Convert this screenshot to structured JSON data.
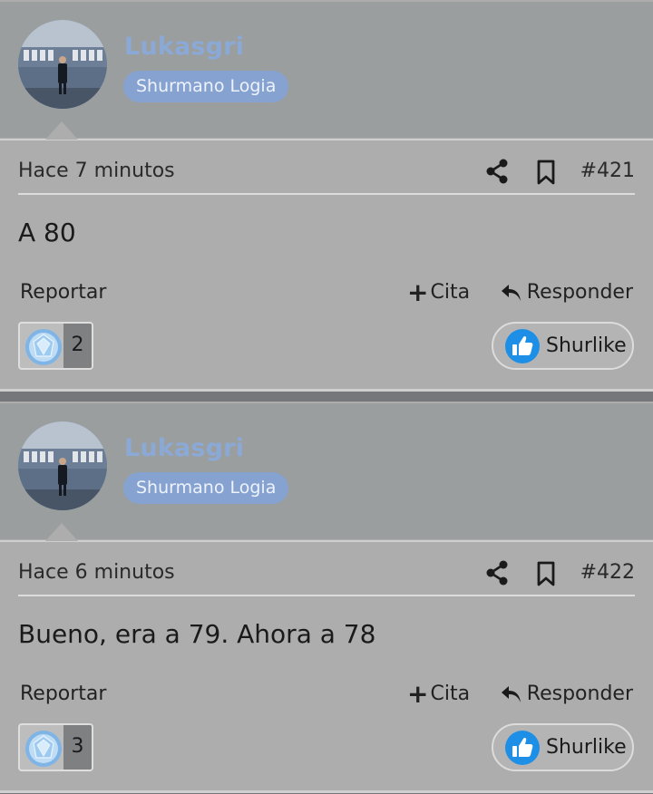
{
  "posts": [
    {
      "author": "Lukasgri",
      "user_title": "Shurmano Logia",
      "time": "Hace 7 minutos",
      "number": "#421",
      "message": "A 80",
      "report_label": "Reportar",
      "quote_label": "Cita",
      "reply_label": "Responder",
      "reaction_count": "2",
      "like_label": "Shurlike"
    },
    {
      "author": "Lukasgri",
      "user_title": "Shurmano Logia",
      "time": "Hace 6 minutos",
      "number": "#422",
      "message": "Bueno, era a 79. Ahora a 78",
      "report_label": "Reportar",
      "quote_label": "Cita",
      "reply_label": "Responder",
      "reaction_count": "3",
      "like_label": "Shurlike"
    }
  ],
  "icons": {
    "share": "share-icon",
    "bookmark": "bookmark-icon",
    "quote": "plus-icon",
    "reply": "reply-arrow-icon",
    "reaction": "diamond-gem-icon",
    "like": "thumbs-up-icon"
  },
  "colors": {
    "username": "#8ba9d6",
    "title_badge": "#86a2d1",
    "like_icon": "#1e8fe6",
    "author_bar": "#9b9e9f",
    "post_bg": "#adadad"
  }
}
